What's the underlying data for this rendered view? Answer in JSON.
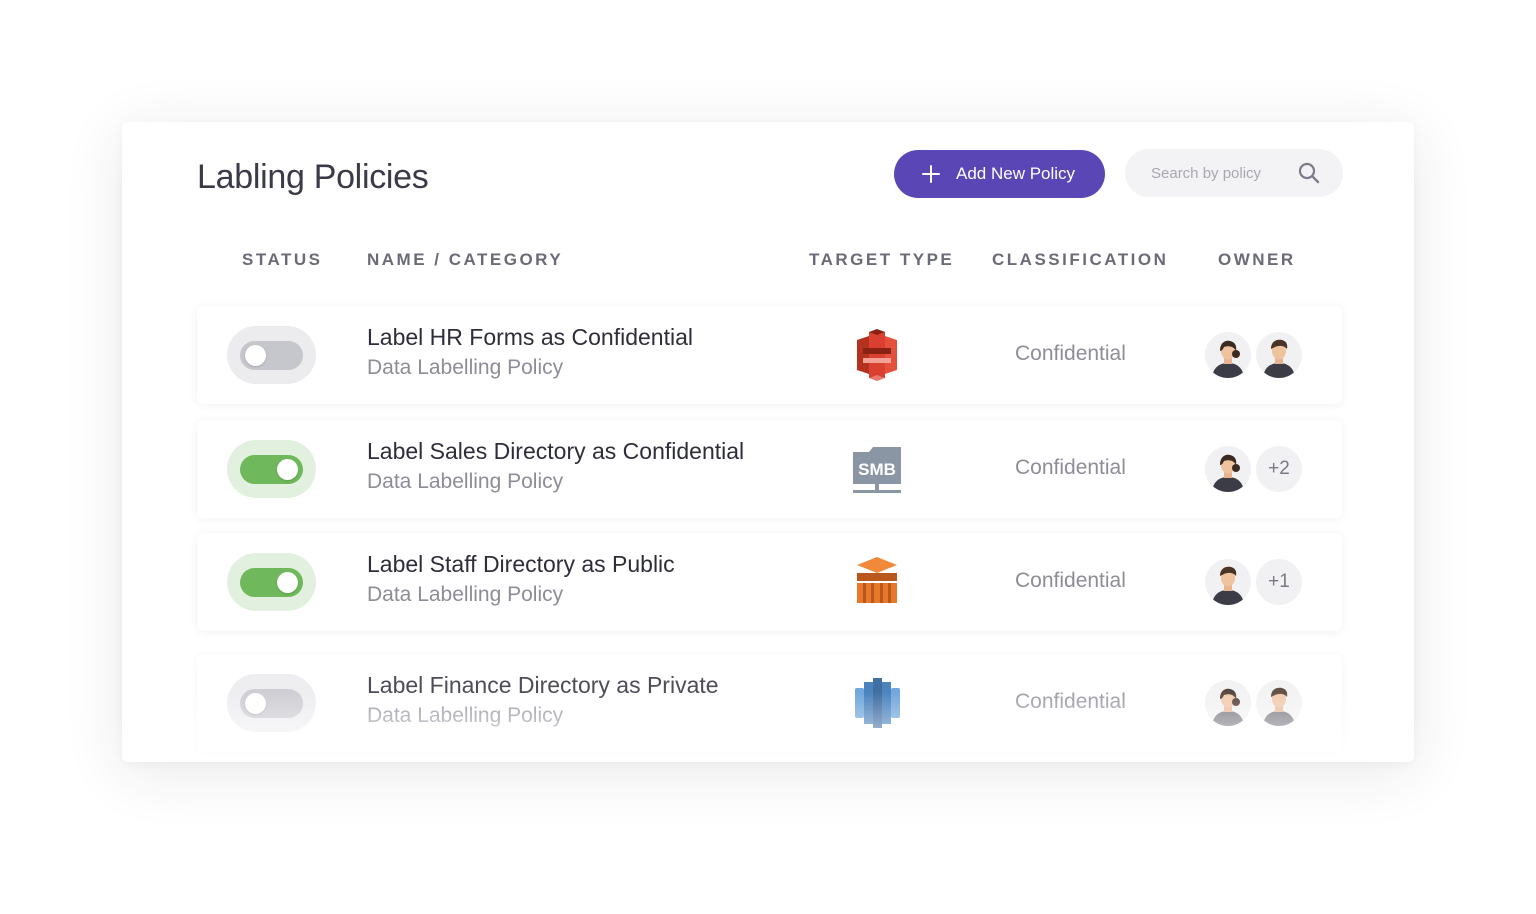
{
  "page": {
    "title": "Labling Policies",
    "add_button_label": "Add New Policy",
    "search_placeholder": "Search by policy"
  },
  "table": {
    "headers": {
      "status": "STATUS",
      "name": "NAME / CATEGORY",
      "target": "TARGET TYPE",
      "classification": "CLASSIFICATION",
      "owner": "OWNER"
    },
    "rows": [
      {
        "enabled": false,
        "name": "Label HR Forms as Confidential",
        "category": "Data Labelling Policy",
        "target_icon": "aws-s3-icon",
        "classification": "Confidential",
        "owners": [
          "female-owner-avatar",
          "male-owner-avatar"
        ],
        "extra_owners": ""
      },
      {
        "enabled": true,
        "name": "Label Sales Directory as Confidential",
        "category": "Data Labelling Policy",
        "target_icon": "smb-share-icon",
        "target_text": "SMB",
        "classification": "Confidential",
        "owners": [
          "female-owner-avatar"
        ],
        "extra_owners": "+2"
      },
      {
        "enabled": true,
        "name": "Label Staff Directory as Public",
        "category": "Data Labelling Policy",
        "target_icon": "aws-storage-gateway-icon",
        "classification": "Confidential",
        "owners": [
          "male-owner-avatar"
        ],
        "extra_owners": "+1"
      },
      {
        "enabled": false,
        "name": "Label Finance Directory as Private",
        "category": "Data Labelling Policy",
        "target_icon": "aws-redshift-icon",
        "classification": "Confidential",
        "owners": [
          "female-owner-avatar",
          "male-owner-avatar"
        ],
        "extra_owners": ""
      }
    ]
  },
  "colors": {
    "accent": "#5a47b5",
    "toggle_on": "#6fb85b",
    "toggle_off": "#c6c6cd",
    "s3_red": "#d9402f",
    "smb_gray": "#8a96a3",
    "gateway_orange": "#e8792c",
    "redshift_blue": "#2e6fb3"
  }
}
